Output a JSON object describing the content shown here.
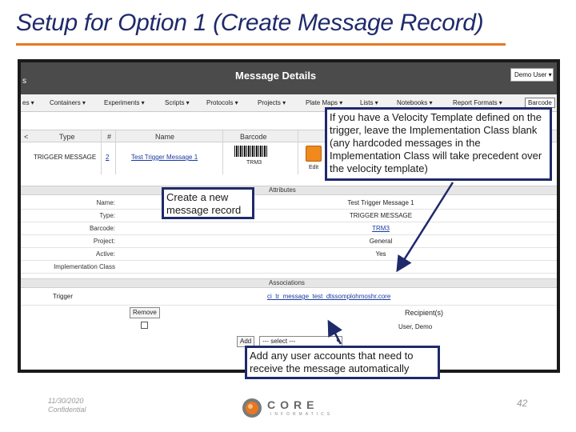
{
  "slide": {
    "title": "Setup for Option 1 (Create Message Record)",
    "footer_date": "11/30/2020",
    "footer_confidential": "Confidential",
    "page_number": "42",
    "logo_text": "CORE",
    "logo_subtext": "INFORMATICS",
    "accent_color": "#e87722",
    "title_color": "#1f2a6b"
  },
  "app": {
    "header_left": "s",
    "title": "Message Details",
    "user_menu": "Demo User ▾",
    "nav": [
      "es ▾",
      "Containers ▾",
      "Experiments ▾",
      "Scripts ▾",
      "Protocols ▾",
      "Projects ▾",
      "Plate Maps ▾",
      "Lists ▾",
      "Notebooks ▾",
      "Report Formats ▾",
      "Barcode"
    ],
    "table": {
      "headers": [
        "<",
        "Type",
        "#",
        "Name",
        "Barcode"
      ],
      "row": {
        "type": "TRIGGER MESSAGE",
        "number": "2",
        "name": "Test Trigger Message 1",
        "barcode_text": "TRM3",
        "edit": "Edit"
      }
    },
    "attributes": {
      "section": "Attributes",
      "value_header": "Test Trigger Message 1",
      "rows": [
        {
          "label": "Name:",
          "value": "Test Trigger Message 1"
        },
        {
          "label": "Type:",
          "value": "TRIGGER MESSAGE"
        },
        {
          "label": "Barcode:",
          "value": "TRM3"
        },
        {
          "label": "Project:",
          "value": "General"
        },
        {
          "label": "Active:",
          "value": "Yes"
        },
        {
          "label": "Implementation Class",
          "value": ""
        }
      ]
    },
    "associations": {
      "section": "Associations",
      "trigger_label": "Trigger",
      "trigger_link": "ci_tr_message_test_dtssomplohmoshr.core",
      "remove_button": "Remove",
      "recipient_header": "Recipient(s)",
      "recipient_value": "User, Demo",
      "add_button": "Add",
      "select_placeholder": "--- select ---"
    }
  },
  "callouts": {
    "create_record": "Create a new message record",
    "velocity_note": "If you have a Velocity Template defined on the trigger, leave the Implementation Class blank (any hardcoded messages in the Implementation Class will take precedent over the velocity template)",
    "add_accounts": "Add any user accounts that need to receive the message automatically"
  }
}
